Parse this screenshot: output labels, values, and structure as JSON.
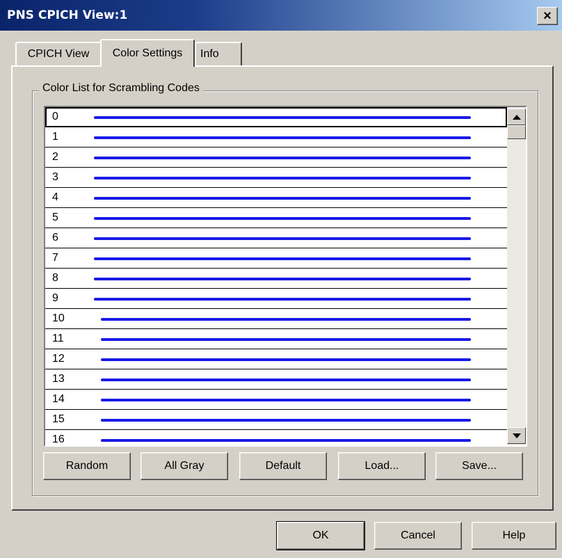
{
  "window": {
    "title": "PNS CPICH View:1",
    "close_symbol": "×"
  },
  "tabs": [
    {
      "label": "CPICH View",
      "active": false
    },
    {
      "label": "Color Settings",
      "active": true
    },
    {
      "label": "Info",
      "active": false
    }
  ],
  "group": {
    "label": "Color List for Scrambling Codes"
  },
  "color_list": {
    "line_color": "#1a1ae6",
    "rows": [
      {
        "code": "0",
        "selected": true
      },
      {
        "code": "1"
      },
      {
        "code": "2"
      },
      {
        "code": "3"
      },
      {
        "code": "4"
      },
      {
        "code": "5"
      },
      {
        "code": "6"
      },
      {
        "code": "7"
      },
      {
        "code": "8"
      },
      {
        "code": "9"
      },
      {
        "code": "10"
      },
      {
        "code": "11"
      },
      {
        "code": "12"
      },
      {
        "code": "13"
      },
      {
        "code": "14"
      },
      {
        "code": "15"
      },
      {
        "code": "16"
      }
    ]
  },
  "list_buttons": {
    "random": "Random",
    "all_gray": "All Gray",
    "default": "Default",
    "load": "Load...",
    "save": "Save..."
  },
  "dialog_buttons": {
    "ok": "OK",
    "cancel": "Cancel",
    "help": "Help"
  }
}
